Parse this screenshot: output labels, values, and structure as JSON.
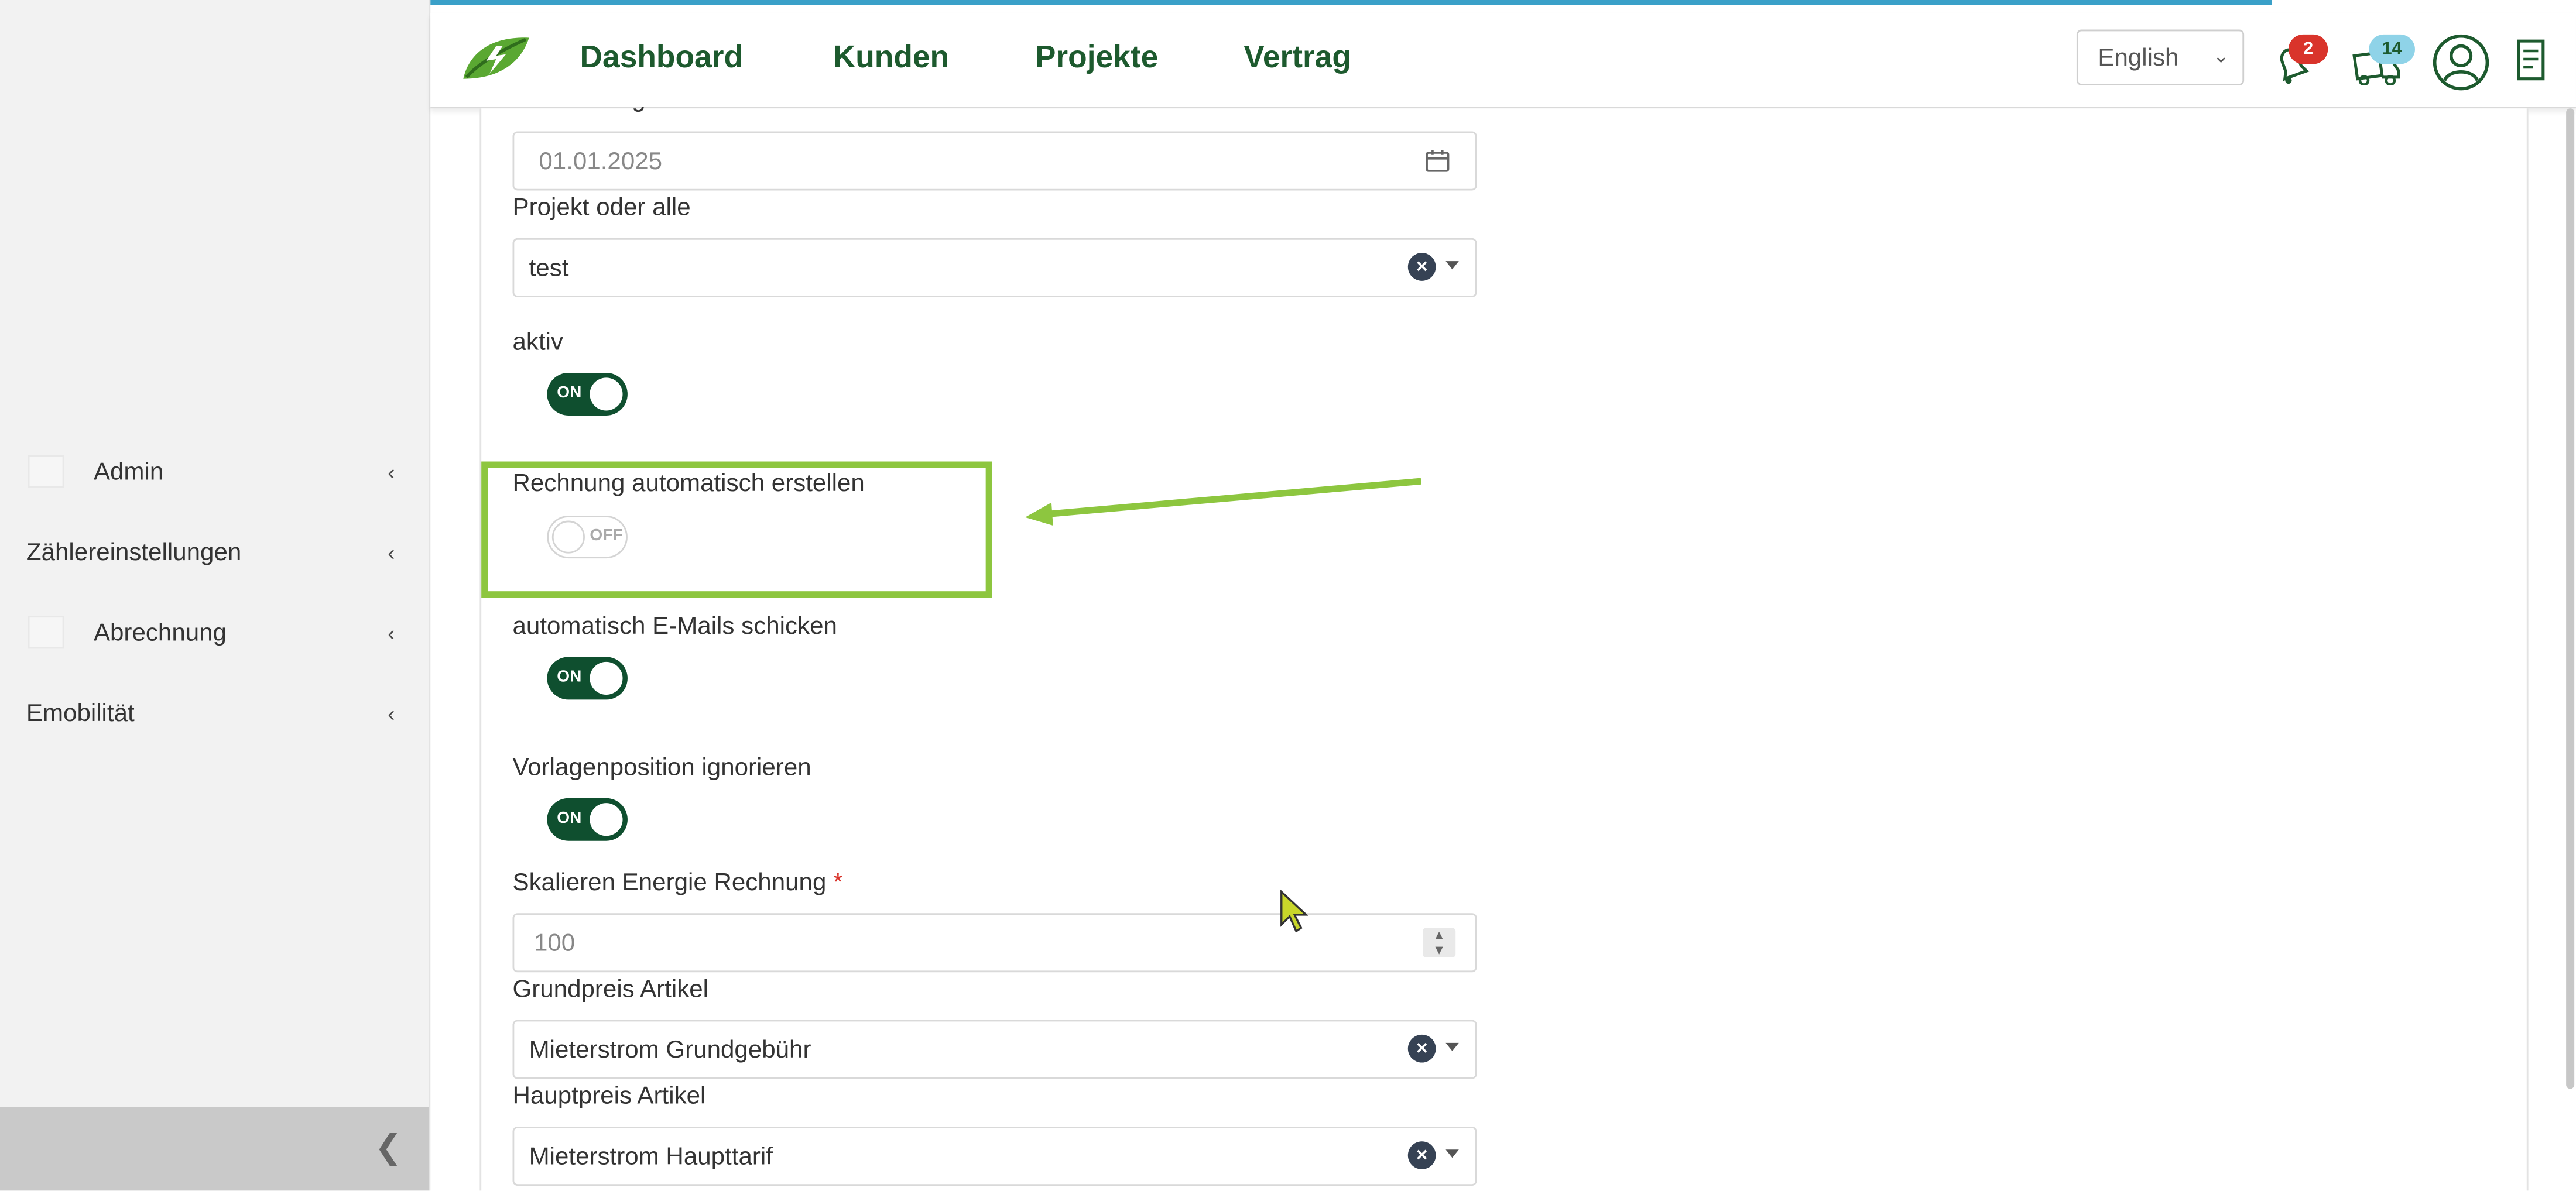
{
  "sidebar": {
    "items": [
      {
        "label": "Admin",
        "has_icon": true
      },
      {
        "label": "Zählereinstellungen",
        "has_icon": false
      },
      {
        "label": "Abrechnung",
        "has_icon": true
      },
      {
        "label": "Emobilität",
        "has_icon": false
      }
    ],
    "collapse_icon": "chevron-left-icon"
  },
  "header": {
    "logo": "leaf-lightning-logo",
    "nav": [
      "Dashboard",
      "Kunden",
      "Projekte",
      "Vertrag"
    ],
    "language": "English",
    "notifications_badge": "2",
    "inbox_badge": "14",
    "icons": [
      "bell-icon",
      "truck-icon",
      "user-avatar-icon",
      "document-icon"
    ],
    "colors": {
      "nav": "#1d5a2e",
      "badge_red": "#d9342b",
      "badge_blue": "#8fd3e8"
    }
  },
  "form": {
    "cut_label": "Abrechnungsstart",
    "date_value": "01.01.2025",
    "projekt_label": "Projekt oder alle",
    "projekt_value": "test",
    "aktiv_label": "aktiv",
    "aktiv_state": "ON",
    "rechnung_label": "Rechnung automatisch erstellen",
    "rechnung_state": "OFF",
    "emails_label": "automatisch E-Mails schicken",
    "emails_state": "ON",
    "vorlagen_label": "Vorlagenposition ignorieren",
    "vorlagen_state": "ON",
    "skalieren_label": "Skalieren Energie Rechnung",
    "required_mark": "*",
    "skalieren_value": "100",
    "grundpreis_label": "Grundpreis Artikel",
    "grundpreis_value": "Mieterstrom Grundgebühr",
    "hauptpreis_label": "Hauptpreis Artikel",
    "hauptpreis_value": "Mieterstrom Haupttarif",
    "toggle_on_color": "#0f4f2f"
  },
  "annotation": {
    "color": "#8dc63f"
  }
}
